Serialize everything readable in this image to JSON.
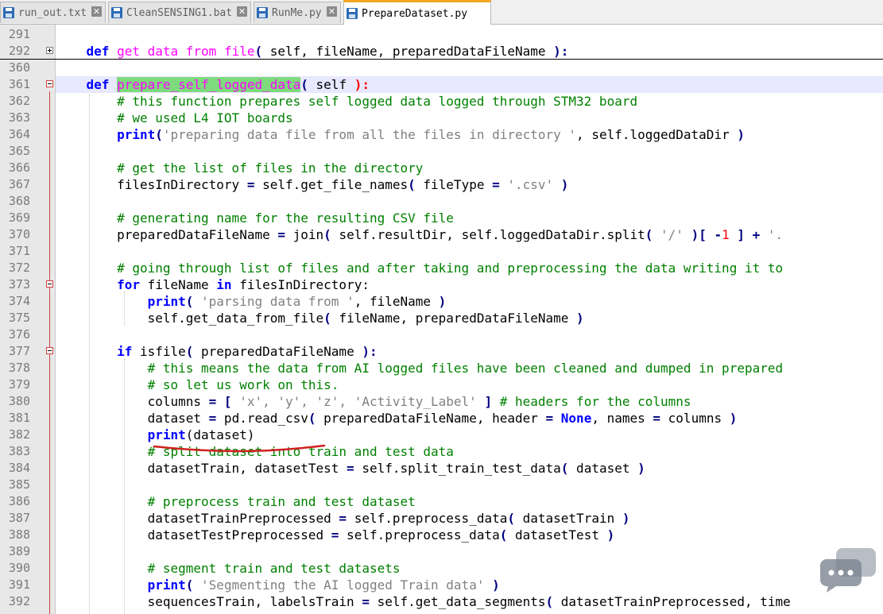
{
  "tabs": [
    {
      "label": "run_out.txt",
      "close": "✕"
    },
    {
      "label": "CleanSENSING1.bat",
      "close": "✕"
    },
    {
      "label": "RunMe.py",
      "close": "✕"
    },
    {
      "label": "PrepareDataset.py",
      "close": "✕"
    }
  ],
  "lines": {
    "291": "291",
    "292": "292",
    "360": "360",
    "361": "361",
    "362": "362",
    "363": "363",
    "364": "364",
    "365": "365",
    "366": "366",
    "367": "367",
    "368": "368",
    "369": "369",
    "370": "370",
    "371": "371",
    "372": "372",
    "373": "373",
    "374": "374",
    "375": "375",
    "376": "376",
    "377": "377",
    "378": "378",
    "379": "379",
    "380": "380",
    "381": "381",
    "382": "382",
    "383": "383",
    "384": "384",
    "385": "385",
    "386": "386",
    "387": "387",
    "388": "388",
    "389": "389",
    "390": "390",
    "391": "391",
    "392": "392"
  },
  "code": {
    "l292": {
      "kw": "def",
      "fn": "get data from file",
      "p1": "(",
      "rest": " self, fileName, preparedDataFileName ",
      "p2": "):"
    },
    "l361": {
      "kw": "def",
      "fn": "prepare_self_logged_data",
      "p1": "(",
      "rest": " self ",
      "p2": "):"
    },
    "l362": "# this function prepares self logged data logged through STM32 board",
    "l363": "# we used L4 IOT boards",
    "l364": {
      "kw": "print",
      "p1": "(",
      "str": "'preparing data file from all the files in directory '",
      "rest": ", self.loggedDataDir ",
      "p2": ")"
    },
    "l366": "# get the list of files in the directory",
    "l367": {
      "a": "filesInDirectory ",
      "eq": "=",
      "b": " self.get_file_names",
      "p1": "(",
      "c": " fileType ",
      "eq2": "=",
      "str": " '.csv' ",
      "p2": ")"
    },
    "l369": "# generating name for the resulting CSV file",
    "l370": {
      "a": "preparedDataFileName ",
      "eq": "=",
      "b": " join",
      "p1": "(",
      "c": " self.resultDir, self.loggedDataDir.split",
      "p3": "(",
      "str": " '/' ",
      "p4": ")[",
      "neg": " -",
      "num": "1",
      "p5": " ]",
      "plus": " +",
      "tail": " '."
    },
    "l372": "# going through list of files and after taking and preprocessing the data writing it to",
    "l373": {
      "kw": "for",
      "a": " fileName ",
      "kw2": "in",
      "b": " filesInDirectory:"
    },
    "l374": {
      "kw": "print",
      "p1": "(",
      "str": " 'parsing data from '",
      "rest": ", fileName ",
      "p2": ")"
    },
    "l375": {
      "a": "self.get_data_from_file",
      "p1": "(",
      "b": " fileName, preparedDataFileName ",
      "p2": ")"
    },
    "l377": {
      "kw": "if",
      "a": " isfile",
      "p1": "(",
      "b": " preparedDataFileName ",
      "p2": "):"
    },
    "l378": "# this means the data from AI logged files have been cleaned and dumped in prepared",
    "l379": "# so let us work on this.",
    "l380": {
      "a": "columns ",
      "eq": "=",
      "p1": " [",
      "str": " 'x', 'y', 'z', 'Activity_Label' ",
      "p2": "]",
      "cm": " # headers for the columns"
    },
    "l381": {
      "a": "dataset ",
      "eq": "=",
      "b": " pd.read_csv",
      "p1": "(",
      "c": " preparedDataFileName, header ",
      "eq2": "=",
      "kw": " None",
      "d": ", names ",
      "eq3": "=",
      "e": " columns ",
      "p2": ")"
    },
    "l382": {
      "kw": "print",
      "a": "(dataset)"
    },
    "l383": "# split dataset into train and test data",
    "l384": {
      "a": "datasetTrain, datasetTest ",
      "eq": "=",
      "b": " self.split_train_test_data",
      "p1": "(",
      "c": " dataset ",
      "p2": ")"
    },
    "l386": "# preprocess train and test dataset",
    "l387": {
      "a": "datasetTrainPreprocessed ",
      "eq": "=",
      "b": " self.preprocess_data",
      "p1": "(",
      "c": " datasetTrain ",
      "p2": ")"
    },
    "l388": {
      "a": "datasetTestPreprocessed ",
      "eq": "=",
      "b": " self.preprocess_data",
      "p1": "(",
      "c": " datasetTest ",
      "p2": ")"
    },
    "l390": "# segment train and test datasets",
    "l391": {
      "kw": "print",
      "p1": "(",
      "str": " 'Segmenting the AI logged Train data' ",
      "p2": ")"
    },
    "l392": {
      "a": "sequencesTrain, labelsTrain ",
      "eq": "=",
      "b": " self.get_data_segments",
      "p1": "(",
      "c": " datasetTrainPreprocessed, time"
    }
  },
  "colors": {
    "keyword": "#0000ff",
    "function": "#ff00ff",
    "comment": "#008000",
    "string": "#808080",
    "operator": "#000080",
    "number": "#ff0000",
    "highlight": "#7ddb7d",
    "active_tab_accent": "#f5a623"
  },
  "icons": [
    "save-icon",
    "close-icon",
    "fold-minus-icon",
    "fold-plus-icon",
    "chat-bubble-watermark-icon"
  ]
}
